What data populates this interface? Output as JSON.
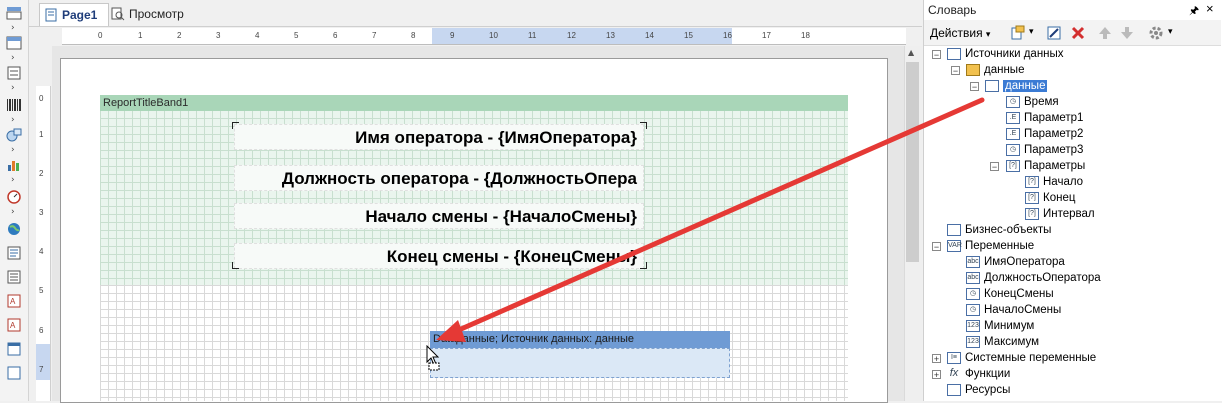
{
  "tabs": {
    "page1": "Page1",
    "preview": "Просмотр"
  },
  "ruler": {
    "ticks": [
      "0",
      "1",
      "2",
      "3",
      "4",
      "5",
      "6",
      "7",
      "8",
      "9",
      "10",
      "11",
      "12",
      "13",
      "14",
      "15",
      "16",
      "17",
      "18"
    ],
    "vticks": [
      "0",
      "1",
      "2",
      "3",
      "4",
      "5",
      "6",
      "7"
    ]
  },
  "report": {
    "title_band": "ReportTitleBand1",
    "fields": [
      "Имя оператора - {ИмяОператора}",
      "Должность оператора - {ДолжностьОпера",
      "Начало смены - {НачалоСмены}",
      "Конец смены - {КонецСмены}"
    ],
    "data_band": "Dataданные; Источник данных: данные"
  },
  "dictionary": {
    "title": "Словарь",
    "pin": "🖈",
    "close": "×",
    "actions": "Действия",
    "tree": [
      {
        "label": "Источники данных",
        "icon": "datasources-icon"
      },
      {
        "label": "данные",
        "icon": "connection-icon"
      },
      {
        "label": "данные",
        "icon": "table-icon"
      },
      {
        "label": "Время",
        "icon": "clock-icon"
      },
      {
        "label": "Параметр1",
        "icon": "param-icon"
      },
      {
        "label": "Параметр2",
        "icon": "param-icon"
      },
      {
        "label": "Параметр3",
        "icon": "param-icon"
      },
      {
        "label": "Параметры",
        "icon": "params-icon"
      },
      {
        "label": "Начало",
        "icon": "param-icon"
      },
      {
        "label": "Конец",
        "icon": "param-icon"
      },
      {
        "label": "Интервал",
        "icon": "param-icon"
      },
      {
        "label": "Бизнес-объекты",
        "icon": "business-icon"
      },
      {
        "label": "Переменные",
        "icon": "variables-icon"
      },
      {
        "label": "ИмяОператора",
        "icon": "abc-icon"
      },
      {
        "label": "ДолжностьОператора",
        "icon": "abc-icon"
      },
      {
        "label": "КонецСмены",
        "icon": "clock-icon"
      },
      {
        "label": "НачалоСмены",
        "icon": "clock-icon"
      },
      {
        "label": "Минимум",
        "icon": "number-icon"
      },
      {
        "label": "Максимум",
        "icon": "number-icon"
      },
      {
        "label": "Системные переменные",
        "icon": "system-vars-icon"
      },
      {
        "label": "Функции",
        "icon": "function-icon"
      },
      {
        "label": "Ресурсы",
        "icon": "resources-icon"
      }
    ]
  },
  "colors": {
    "title_band": "#a9d6b8",
    "data_band": "#6f9bd4",
    "arrow": "#e53935",
    "selection": "#3b7bd4"
  }
}
